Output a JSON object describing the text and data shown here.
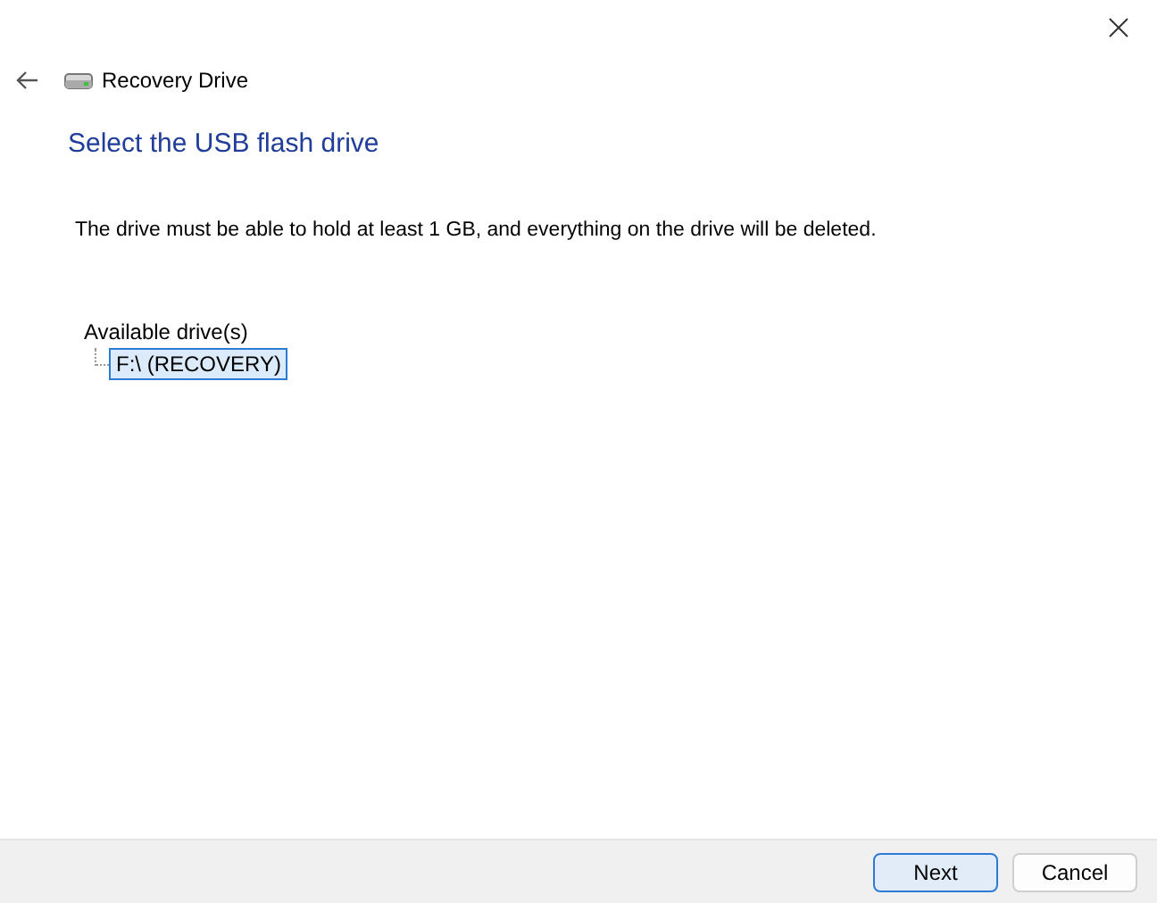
{
  "window": {
    "title": "Recovery Drive"
  },
  "heading": "Select the USB flash drive",
  "description": "The drive must be able to hold at least 1 GB, and everything on the drive will be deleted.",
  "tree": {
    "label": "Available drive(s)",
    "children": [
      {
        "label": "F:\\ (RECOVERY)",
        "selected": true
      }
    ]
  },
  "buttons": [
    {
      "label": "Next",
      "default": true
    },
    {
      "label": "Cancel",
      "default": false
    }
  ]
}
